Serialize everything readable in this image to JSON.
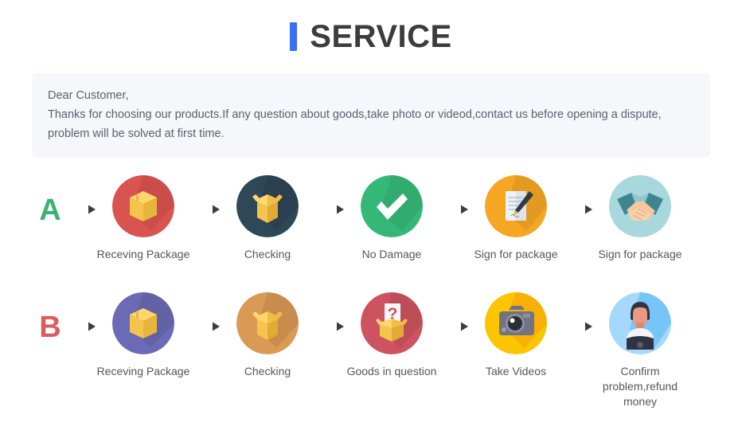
{
  "header": {
    "title": "SERVICE",
    "accent_bar_color": "#3b6ef6",
    "title_color": "#3c3c3c"
  },
  "notice": {
    "background": "#f6f7fb",
    "line1": "Dear Customer,",
    "line2": "Thanks for choosing our products.If any question about goods,take photo or videod,contact us before opening a dispute,",
    "line3": "problem will be solved at first time."
  },
  "flows": [
    {
      "letter": "A",
      "letter_color": "#3bb273",
      "steps": [
        {
          "icon": "package-box-icon",
          "label": "Receving Package",
          "circle_color": "#d9534f"
        },
        {
          "icon": "open-box-icon",
          "label": "Checking",
          "circle_color": "#2f4858"
        },
        {
          "icon": "check-mark-icon",
          "label": "No Damage",
          "circle_color": "#35b877"
        },
        {
          "icon": "sign-document-icon",
          "label": "Sign for package",
          "circle_color": "#f5a623"
        },
        {
          "icon": "handshake-icon",
          "label": "Sign for package",
          "circle_color": "#a8d8de"
        }
      ]
    },
    {
      "letter": "B",
      "letter_color": "#db5d5d",
      "steps": [
        {
          "icon": "package-box-icon",
          "label": "Receving Package",
          "circle_color": "#6b6bb5"
        },
        {
          "icon": "open-box-icon",
          "label": "Checking",
          "circle_color": "#d99a54"
        },
        {
          "icon": "question-box-icon",
          "label": "Goods in question",
          "circle_color": "#cd5361"
        },
        {
          "icon": "camera-icon",
          "label": "Take Videos",
          "circle_color": "#fdc500"
        },
        {
          "icon": "person-avatar-icon",
          "label": "Confirm  problem,refund\nmoney",
          "circle_color": "#8fcdf5"
        }
      ]
    }
  ],
  "arrow": {
    "name": "right-arrow-icon",
    "color": "#4a4a4a"
  }
}
